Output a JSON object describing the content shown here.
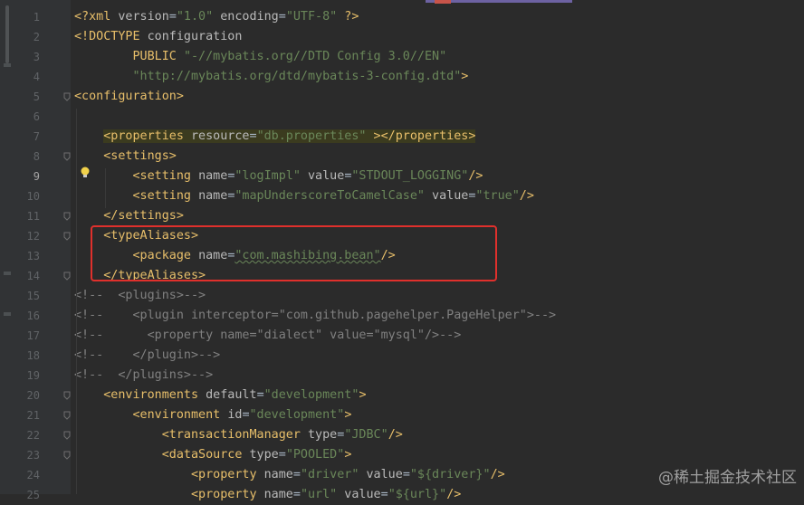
{
  "editor": {
    "lines": [
      {
        "n": "1",
        "tokens": [
          [
            "t-punct",
            "<?xml "
          ],
          [
            "t-attr",
            "version"
          ],
          [
            "t-txt",
            "="
          ],
          [
            "t-val",
            "\"1.0\""
          ],
          [
            "t-attr",
            " encoding"
          ],
          [
            "t-txt",
            "="
          ],
          [
            "t-val",
            "\"UTF-8\""
          ],
          [
            "t-punct",
            " ?>"
          ]
        ]
      },
      {
        "n": "2",
        "tokens": [
          [
            "t-punct",
            "<!DOCTYPE "
          ],
          [
            "t-attr",
            "configuration"
          ]
        ]
      },
      {
        "n": "3",
        "tokens": [
          [
            "t-txt",
            "        "
          ],
          [
            "t-tag",
            "PUBLIC "
          ],
          [
            "t-val",
            "\"-//mybatis.org//DTD Config 3.0//EN\""
          ]
        ]
      },
      {
        "n": "4",
        "tokens": [
          [
            "t-txt",
            "        "
          ],
          [
            "t-val",
            "\"http://mybatis.org/dtd/mybatis-3-config.dtd\""
          ],
          [
            "t-punct",
            ">"
          ]
        ]
      },
      {
        "n": "5",
        "tokens": [
          [
            "t-tag",
            "<configuration>"
          ]
        ]
      },
      {
        "n": "6",
        "tokens": []
      },
      {
        "n": "7",
        "tokens": [
          [
            "t-txt",
            "    "
          ],
          [
            "t-tag hl-props",
            "<properties "
          ],
          [
            "t-attr hl-props",
            "resource"
          ],
          [
            "t-txt hl-props",
            "="
          ],
          [
            "t-val hl-props",
            "\"db.properties\""
          ],
          [
            "t-tag hl-props",
            " ></properties>"
          ]
        ]
      },
      {
        "n": "8",
        "tokens": [
          [
            "t-txt",
            "    "
          ],
          [
            "t-tag",
            "<settings>"
          ]
        ]
      },
      {
        "n": "9",
        "tokens": [
          [
            "t-txt",
            "        "
          ],
          [
            "t-tag",
            "<setting "
          ],
          [
            "t-attr",
            "name"
          ],
          [
            "t-txt",
            "="
          ],
          [
            "t-val",
            "\"logImpl\""
          ],
          [
            "t-attr",
            " value"
          ],
          [
            "t-txt",
            "="
          ],
          [
            "t-val",
            "\"STDOUT_LOGGING\""
          ],
          [
            "t-tag",
            "/>"
          ]
        ]
      },
      {
        "n": "10",
        "tokens": [
          [
            "t-txt",
            "        "
          ],
          [
            "t-tag",
            "<setting "
          ],
          [
            "t-attr",
            "name"
          ],
          [
            "t-txt",
            "="
          ],
          [
            "t-val",
            "\"mapUnderscoreToCamelCase\""
          ],
          [
            "t-attr",
            " value"
          ],
          [
            "t-txt",
            "="
          ],
          [
            "t-val",
            "\"true\""
          ],
          [
            "t-tag",
            "/>"
          ]
        ]
      },
      {
        "n": "11",
        "tokens": [
          [
            "t-txt",
            "    "
          ],
          [
            "t-tag",
            "</settings>"
          ]
        ]
      },
      {
        "n": "12",
        "tokens": [
          [
            "t-txt",
            "    "
          ],
          [
            "t-tag",
            "<typeAliases>"
          ]
        ]
      },
      {
        "n": "13",
        "tokens": [
          [
            "t-txt",
            "        "
          ],
          [
            "t-tag",
            "<package "
          ],
          [
            "t-attr",
            "name"
          ],
          [
            "t-txt",
            "="
          ],
          [
            "t-val",
            "\"com.mashibing.bean\""
          ],
          [
            "t-tag",
            "/>"
          ]
        ]
      },
      {
        "n": "14",
        "tokens": [
          [
            "t-txt",
            "    "
          ],
          [
            "t-tag",
            "</typeAliases>"
          ]
        ]
      },
      {
        "n": "15",
        "tokens": [
          [
            "t-comment",
            "<!--  <plugins>-->"
          ]
        ]
      },
      {
        "n": "16",
        "tokens": [
          [
            "t-comment",
            "<!--    <plugin interceptor=\"com.github.pagehelper.PageHelper\">-->"
          ]
        ]
      },
      {
        "n": "17",
        "tokens": [
          [
            "t-comment",
            "<!--      <property name=\"dialect\" value=\"mysql\"/>-->"
          ]
        ]
      },
      {
        "n": "18",
        "tokens": [
          [
            "t-comment",
            "<!--    </plugin>-->"
          ]
        ]
      },
      {
        "n": "19",
        "tokens": [
          [
            "t-comment",
            "<!--  </plugins>-->"
          ]
        ]
      },
      {
        "n": "20",
        "tokens": [
          [
            "t-txt",
            "    "
          ],
          [
            "t-tag",
            "<environments "
          ],
          [
            "t-attr",
            "default"
          ],
          [
            "t-txt",
            "="
          ],
          [
            "t-val",
            "\"development\""
          ],
          [
            "t-tag",
            ">"
          ]
        ]
      },
      {
        "n": "21",
        "tokens": [
          [
            "t-txt",
            "        "
          ],
          [
            "t-tag",
            "<environment "
          ],
          [
            "t-attr",
            "id"
          ],
          [
            "t-txt",
            "="
          ],
          [
            "t-val",
            "\"development\""
          ],
          [
            "t-tag",
            ">"
          ]
        ]
      },
      {
        "n": "22",
        "tokens": [
          [
            "t-txt",
            "            "
          ],
          [
            "t-tag",
            "<transactionManager "
          ],
          [
            "t-attr",
            "type"
          ],
          [
            "t-txt",
            "="
          ],
          [
            "t-val",
            "\"JDBC\""
          ],
          [
            "t-tag",
            "/>"
          ]
        ]
      },
      {
        "n": "23",
        "tokens": [
          [
            "t-txt",
            "            "
          ],
          [
            "t-tag",
            "<dataSource "
          ],
          [
            "t-attr",
            "type"
          ],
          [
            "t-txt",
            "="
          ],
          [
            "t-val",
            "\"POOLED\""
          ],
          [
            "t-tag",
            ">"
          ]
        ]
      },
      {
        "n": "24",
        "tokens": [
          [
            "t-txt",
            "                "
          ],
          [
            "t-tag",
            "<property "
          ],
          [
            "t-attr",
            "name"
          ],
          [
            "t-txt",
            "="
          ],
          [
            "t-val",
            "\"driver\""
          ],
          [
            "t-attr",
            " value"
          ],
          [
            "t-txt",
            "="
          ],
          [
            "t-val",
            "\"${driver}\""
          ],
          [
            "t-tag",
            "/>"
          ]
        ]
      },
      {
        "n": "25",
        "tokens": [
          [
            "t-txt",
            "                "
          ],
          [
            "t-tag",
            "<property "
          ],
          [
            "t-attr",
            "name"
          ],
          [
            "t-txt",
            "="
          ],
          [
            "t-val",
            "\"url\""
          ],
          [
            "t-attr",
            " value"
          ],
          [
            "t-txt",
            "="
          ],
          [
            "t-val",
            "\"${url}\""
          ],
          [
            "t-tag",
            "/>"
          ]
        ]
      }
    ],
    "current_line": "9"
  },
  "colors": {
    "background": "#2b2b2b",
    "gutter": "#313335",
    "tag": "#e8bf6a",
    "attribute": "#bababa",
    "string": "#6a8759",
    "comment": "#808080",
    "highlight_box": "#e0302c"
  },
  "watermark": "@稀土掘金技术社区"
}
